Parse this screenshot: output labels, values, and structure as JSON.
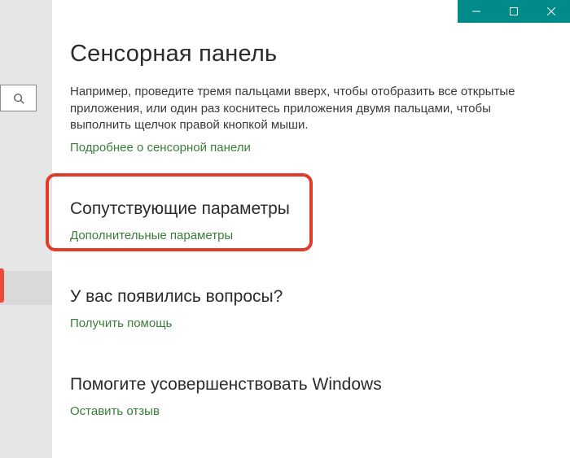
{
  "titlebar": {
    "minimize_label": "Minimize",
    "maximize_label": "Maximize",
    "close_label": "Close"
  },
  "search": {
    "placeholder": ""
  },
  "page": {
    "title": "Сенсорная панель",
    "description": "Например, проведите тремя пальцами вверх, чтобы отобразить все открытые приложения, или один раз коснитесь приложения двумя пальцами, чтобы выполнить щелчок правой кнопкой мыши.",
    "learn_more": "Подробнее о сенсорной панели"
  },
  "related": {
    "title": "Сопутствующие параметры",
    "link": "Дополнительные параметры"
  },
  "help": {
    "title": "У вас появились вопросы?",
    "link": "Получить помощь"
  },
  "feedback": {
    "title": "Помогите усовершенствовать Windows",
    "link": "Оставить отзыв"
  }
}
